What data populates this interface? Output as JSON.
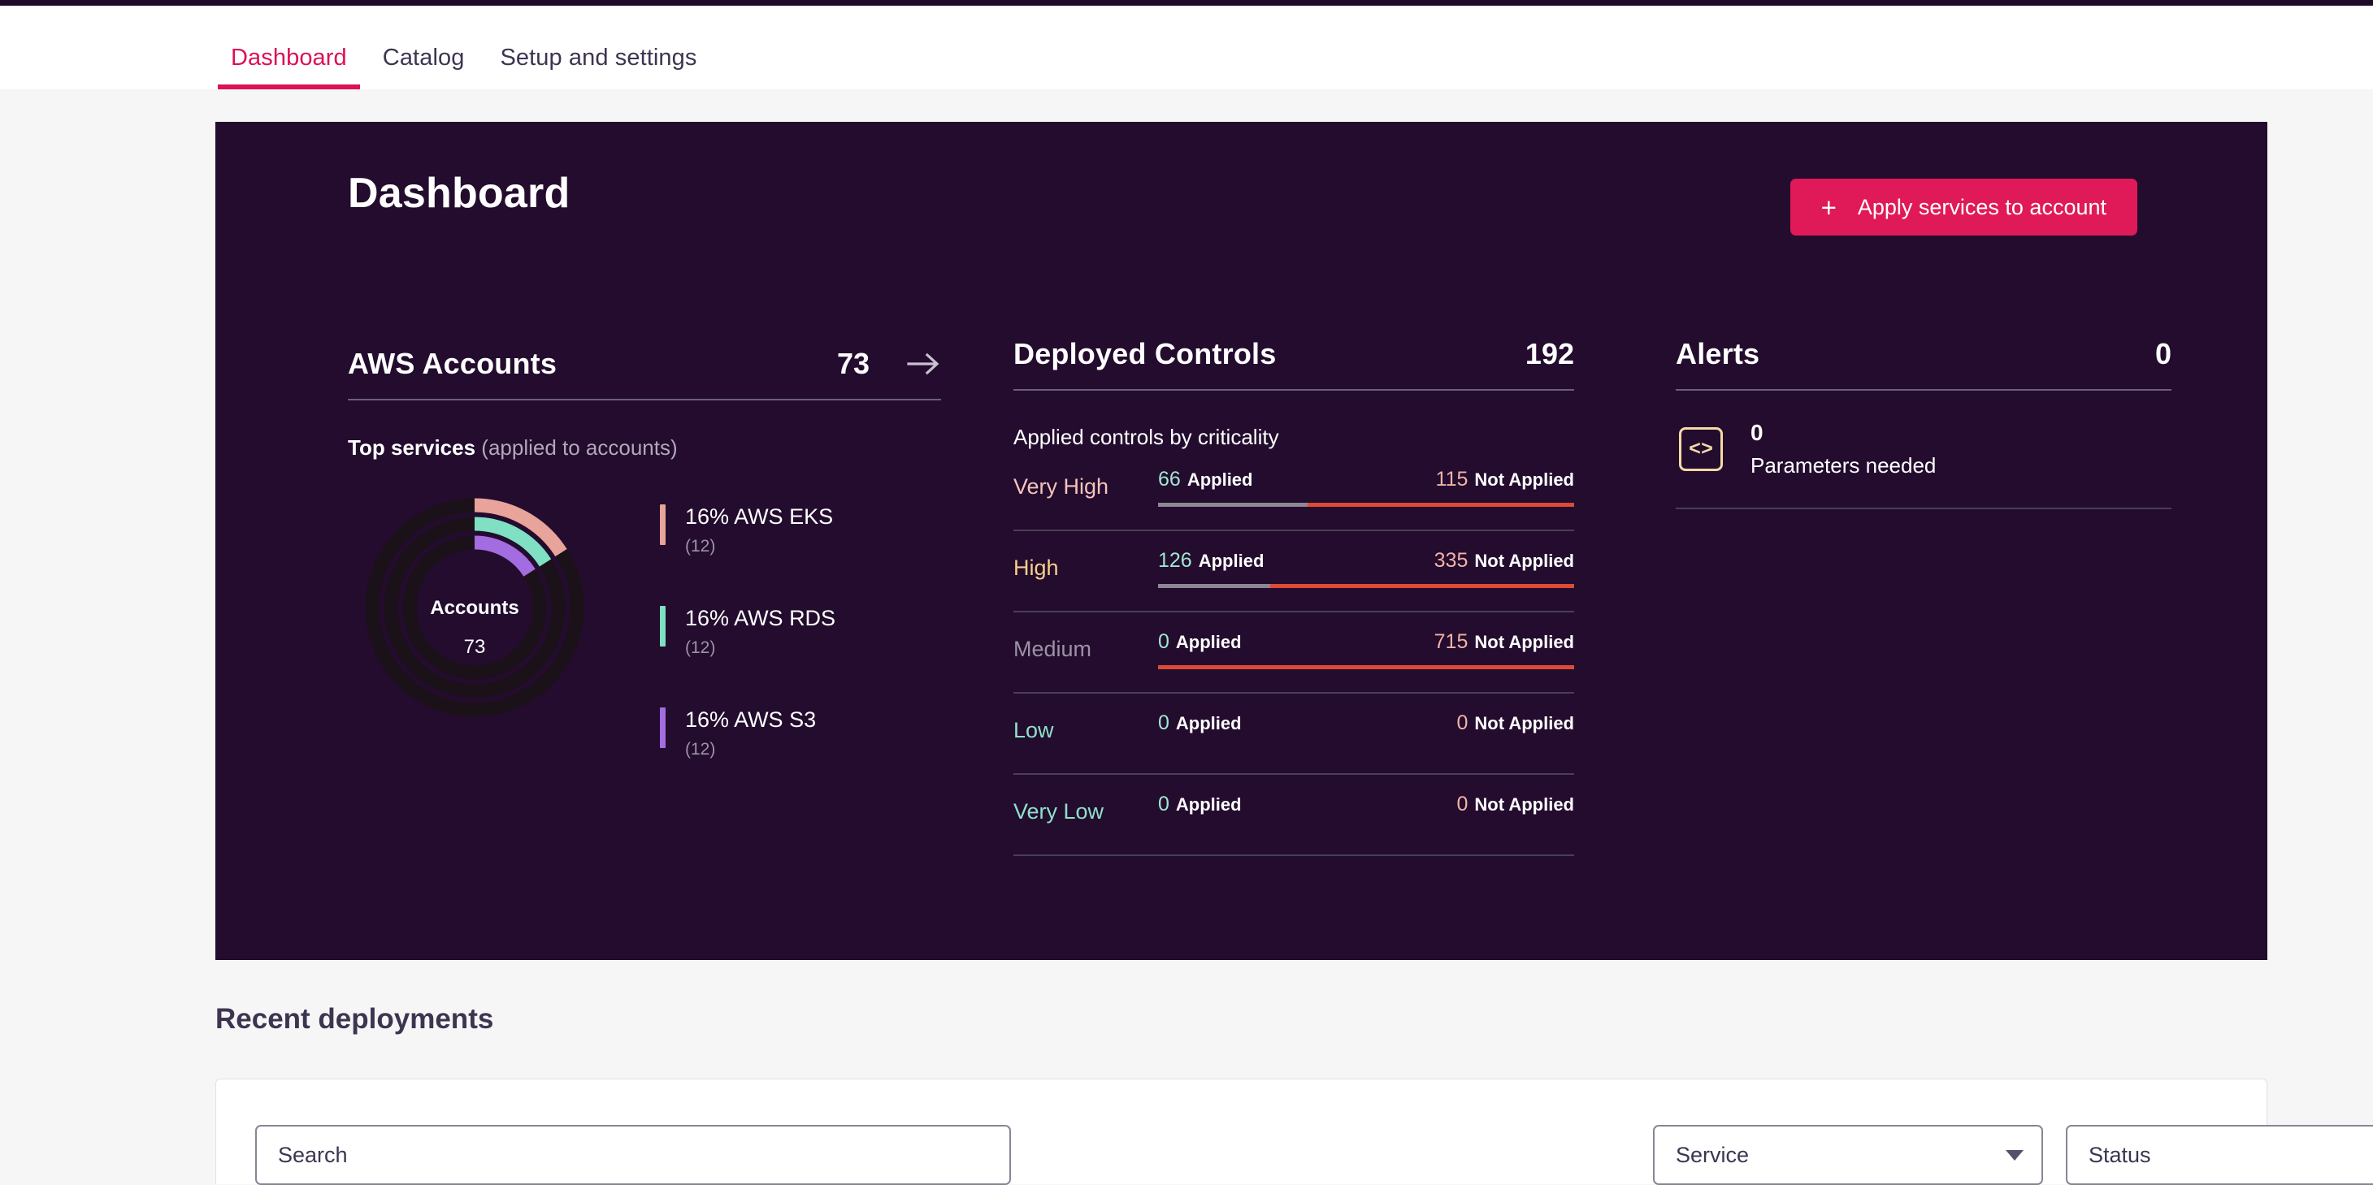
{
  "nav": {
    "tabs": [
      {
        "label": "Dashboard",
        "active": true
      },
      {
        "label": "Catalog",
        "active": false
      },
      {
        "label": "Setup and settings",
        "active": false
      }
    ]
  },
  "hero": {
    "title": "Dashboard",
    "apply_button": {
      "label": "Apply services to account",
      "icon": "plus-icon",
      "plus": "+"
    }
  },
  "accounts": {
    "heading": "AWS Accounts",
    "count": "73",
    "arrow_icon": "arrow-right-icon",
    "top_services_label": "Top services",
    "top_services_sub": "(applied to accounts)",
    "donut": {
      "center_title": "Accounts",
      "center_value": "73"
    },
    "legend": [
      {
        "pct": "16%",
        "name": "AWS EKS",
        "sub": "(12)",
        "color": "#e8a39b"
      },
      {
        "pct": "16%",
        "name": "AWS RDS",
        "sub": "(12)",
        "color": "#7fe0c3"
      },
      {
        "pct": "16%",
        "name": "AWS S3",
        "sub": "(12)",
        "color": "#a36ce0"
      }
    ]
  },
  "controls": {
    "heading": "Deployed Controls",
    "count": "192",
    "subtitle": "Applied controls by criticality",
    "applied_label": "Applied",
    "not_applied_label": "Not Applied",
    "rows": [
      {
        "name": "Very High",
        "name_color": "#f4c4bb",
        "applied": "66",
        "not_applied": "115",
        "applied_pct": 36,
        "show_bar": true
      },
      {
        "name": "High",
        "name_color": "#f5d08b",
        "applied": "126",
        "not_applied": "335",
        "applied_pct": 27,
        "show_bar": true
      },
      {
        "name": "Medium",
        "name_color": "#9b93a5",
        "applied": "0",
        "not_applied": "715",
        "applied_pct": 0,
        "show_bar": true
      },
      {
        "name": "Low",
        "name_color": "#8fe0cb",
        "applied": "0",
        "not_applied": "0",
        "applied_pct": 0,
        "show_bar": false
      },
      {
        "name": "Very Low",
        "name_color": "#8fe0cb",
        "applied": "0",
        "not_applied": "0",
        "applied_pct": 0,
        "show_bar": false
      }
    ]
  },
  "alerts": {
    "heading": "Alerts",
    "count": "0",
    "item": {
      "icon": "code-brackets-icon",
      "icon_glyph": "<>",
      "value": "0",
      "label": "Parameters needed"
    }
  },
  "recent": {
    "title": "Recent deployments",
    "search_placeholder": "Search",
    "search_value": "",
    "filters": [
      {
        "label": "Service",
        "icon": "chevron-down-icon"
      },
      {
        "label": "Status",
        "icon": "chevron-down-icon"
      }
    ]
  },
  "chart_data": {
    "type": "pie",
    "title": "Top services (applied to accounts)",
    "center_label": "Accounts",
    "center_value": 73,
    "total": 73,
    "categories": [
      "AWS EKS",
      "AWS RDS",
      "AWS S3"
    ],
    "values": [
      12,
      12,
      12
    ],
    "percents": [
      16,
      16,
      16
    ],
    "colors": [
      "#e8a39b",
      "#7fe0c3",
      "#a36ce0"
    ],
    "track_color": "#1b1119",
    "legend": "right",
    "rings": 3
  }
}
